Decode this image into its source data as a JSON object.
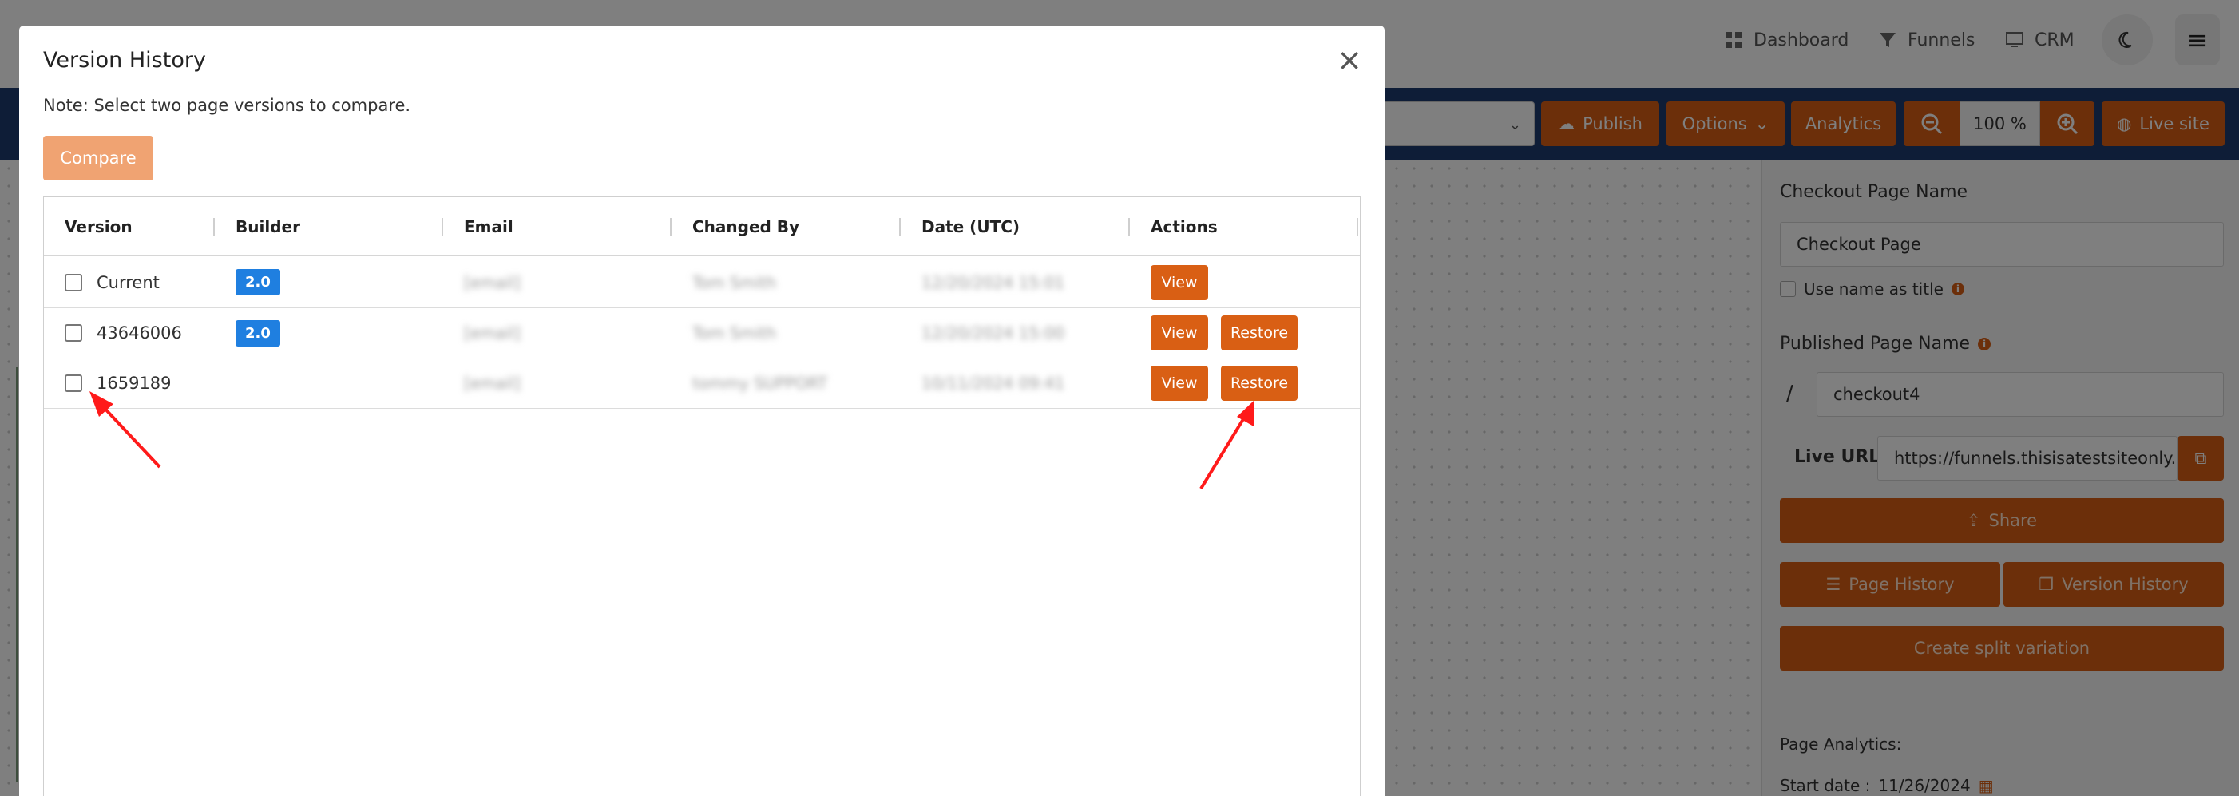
{
  "nav": {
    "dashboard": "Dashboard",
    "funnels": "Funnels",
    "crm": "CRM"
  },
  "toolbar": {
    "publish": "Publish",
    "options": "Options",
    "analytics": "Analytics",
    "zoom": "100 %",
    "live_site": "Live site"
  },
  "panel": {
    "checkout_label": "Checkout Page Name",
    "checkout_value": "Checkout Page",
    "use_name_as_title": "Use name as title",
    "published_label": "Published Page Name",
    "slash": "/",
    "published_value": "checkout4",
    "live_url_label": "Live URL",
    "live_url_value": "https://funnels.thisisatestsiteonly.c",
    "share": "Share",
    "page_history": "Page History",
    "version_history": "Version History",
    "create_split": "Create split variation",
    "analytics_label": "Page Analytics:",
    "start_date_label": "Start date :",
    "start_date_value": "11/26/2024"
  },
  "modal": {
    "title": "Version History",
    "close": "×",
    "note": "Note: Select two page versions to compare.",
    "compare": "Compare",
    "columns": {
      "version": "Version",
      "builder": "Builder",
      "email": "Email",
      "changed_by": "Changed By",
      "date": "Date (UTC)",
      "actions": "Actions"
    },
    "view_label": "View",
    "restore_label": "Restore",
    "rows": [
      {
        "version": "Current",
        "builder": "2.0",
        "email": "[email]",
        "changed_by": "Tom Smith",
        "date": "12/20/2024 15:01"
      },
      {
        "version": "43646006",
        "builder": "2.0",
        "email": "[email]",
        "changed_by": "Tom Smith",
        "date": "12/20/2024 15:00"
      },
      {
        "version": "1659189",
        "builder": "",
        "email": "[email]",
        "changed_by": "tommy SUPPORT",
        "date": "10/11/2024 09:41"
      }
    ]
  },
  "colors": {
    "accent": "#d95f14",
    "toolbar": "#1d3a6e",
    "badge": "#1f7fe0",
    "annotation": "#ff1a1a"
  }
}
